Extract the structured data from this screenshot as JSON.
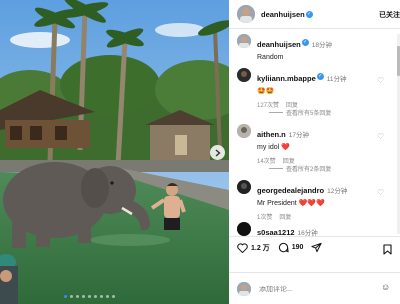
{
  "post": {
    "username": "deanhuijsen",
    "follow_state": "已关注",
    "more": "•••",
    "caption_author": "deanhuijsen",
    "caption_time": "18分钟",
    "caption_text": "Random"
  },
  "comments": [
    {
      "username": "kyliiann.mbappe",
      "time": "11分钟",
      "text": "🤩🤩",
      "likes": "127次赞",
      "reply": "回复",
      "view_replies": "查看所有5条回复"
    },
    {
      "username": "aithen.n",
      "time": "17分钟",
      "text": "my idol ❤️",
      "likes": "14次赞",
      "reply": "回复",
      "view_replies": "查看所有2条回复"
    },
    {
      "username": "georgedealejandro",
      "time": "12分钟",
      "text": "Mr President ❤️❤️❤️",
      "likes": "1次赞",
      "reply": "回复"
    },
    {
      "username": "s0saa1212",
      "time": "16分钟",
      "text": ""
    }
  ],
  "actions": {
    "likes_count": "1.2 万",
    "comments_count": "190"
  },
  "add_comment": {
    "placeholder": "添加评论...",
    "emoji": "☺"
  },
  "carousel": {
    "total_dots": 9,
    "active_index": 0
  },
  "colors": {
    "verified": "#3897f0",
    "carousel_active": "#3b8ef0"
  }
}
